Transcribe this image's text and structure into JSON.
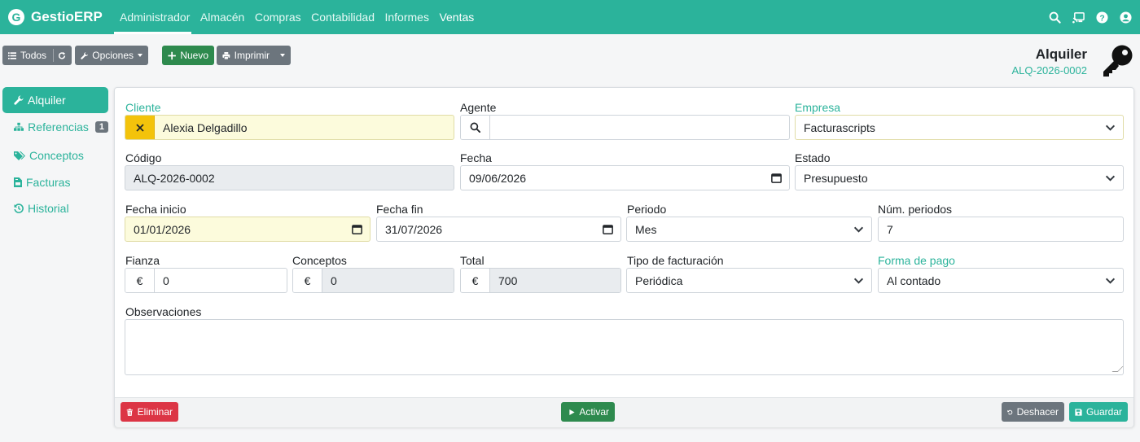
{
  "brand": {
    "logo_letter": "G",
    "name": "GestioERP"
  },
  "nav": {
    "items": [
      "Administrador",
      "Almacén",
      "Compras",
      "Contabilidad",
      "Informes",
      "Ventas"
    ]
  },
  "nav_icons": [
    "search-icon",
    "cast-icon",
    "help-icon",
    "user-icon"
  ],
  "toolbar": {
    "all_label": "Todos",
    "options_label": "Opciones",
    "new_label": "Nuevo",
    "print_label": "Imprimir"
  },
  "header": {
    "title": "Alquiler",
    "code": "ALQ-2026-0002"
  },
  "sidebar": {
    "items": [
      {
        "label": "Alquiler",
        "icon": "wrench-icon",
        "active": true
      },
      {
        "label": "Referencias",
        "icon": "sitemap-icon",
        "badge": "1"
      },
      {
        "label": "Conceptos",
        "icon": "tags-icon"
      },
      {
        "label": "Facturas",
        "icon": "file-invoice-icon"
      },
      {
        "label": "Historial",
        "icon": "history-icon"
      }
    ]
  },
  "form": {
    "cliente": {
      "label": "Cliente",
      "value": "Alexia Delgadillo"
    },
    "agente": {
      "label": "Agente",
      "value": ""
    },
    "empresa": {
      "label": "Empresa",
      "value": "Facturascripts"
    },
    "codigo": {
      "label": "Código",
      "value": "ALQ-2026-0002"
    },
    "fecha": {
      "label": "Fecha",
      "value": "09/06/2026"
    },
    "estado": {
      "label": "Estado",
      "value": "Presupuesto"
    },
    "fecha_inicio": {
      "label": "Fecha inicio",
      "value": "01/01/2026"
    },
    "fecha_fin": {
      "label": "Fecha fin",
      "value": "31/07/2026"
    },
    "periodo": {
      "label": "Periodo",
      "value": "Mes"
    },
    "num_periodos": {
      "label": "Núm. periodos",
      "value": "7"
    },
    "fianza": {
      "label": "Fianza",
      "value": "0",
      "currency": "€"
    },
    "conceptos": {
      "label": "Conceptos",
      "value": "0",
      "currency": "€"
    },
    "total": {
      "label": "Total",
      "value": "700",
      "currency": "€"
    },
    "tipo_facturacion": {
      "label": "Tipo de facturación",
      "value": "Periódica"
    },
    "forma_pago": {
      "label": "Forma de pago",
      "value": "Al contado"
    },
    "observaciones": {
      "label": "Observaciones",
      "value": ""
    }
  },
  "footer": {
    "delete_label": "Eliminar",
    "activate_label": "Activar",
    "undo_label": "Deshacer",
    "save_label": "Guardar"
  },
  "colors": {
    "primary": "#2bb39b",
    "success": "#2e8a4e",
    "danger": "#dc3545",
    "secondary": "#6c757d",
    "warning": "#f3c30b"
  }
}
